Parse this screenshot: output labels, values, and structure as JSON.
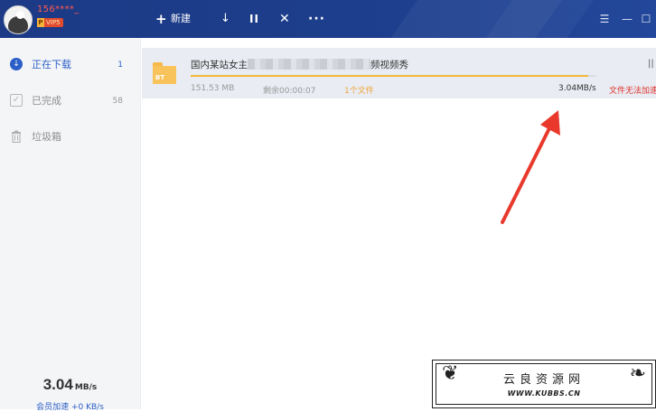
{
  "user": {
    "name": "156****_",
    "badge": "VIP5",
    "badge_icon": "P"
  },
  "toolbar": {
    "plus_icon": "+",
    "new_label": "新建",
    "download_icon": "↓",
    "pause_icon": "II",
    "close_icon": "✕",
    "more_icon": "···"
  },
  "window": {
    "menu_icon": "☰",
    "minimize_icon": "—",
    "maximize_icon": "☐"
  },
  "sidebar": {
    "items": [
      {
        "label": "正在下载",
        "count": "1",
        "icon": "download-circle-icon"
      },
      {
        "label": "已完成",
        "count": "58",
        "icon": "check-box-icon"
      },
      {
        "label": "垃圾箱",
        "count": "",
        "icon": "trash-icon"
      }
    ],
    "speed": {
      "value": "3.04",
      "unit": "MB/s"
    },
    "member_speed": "会员加速 +0 KB/s"
  },
  "downloads": [
    {
      "type_label": "BT",
      "name_prefix": "国内某站女主",
      "name_suffix": "频视频秀",
      "progress": 0.98,
      "size": "151.53 MB",
      "remaining": "剩余00:00:07",
      "files": "1个文件",
      "rate": "3.04MB/s",
      "status": "文件无法加速"
    }
  ],
  "watermark": {
    "title": "云良资源网",
    "url": "WWW.KUBBS.CN"
  },
  "colors": {
    "topbar": "#1d3e8c",
    "accent": "#2b5fc7",
    "progress": "#f3b83c",
    "error": "#e0302a",
    "arrow": "#e8392c"
  }
}
